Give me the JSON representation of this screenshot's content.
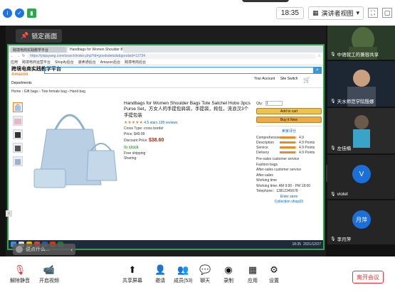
{
  "topbar": {
    "clock": "18:35",
    "view_label": "演讲者视图",
    "icons": [
      "info-icon",
      "shield-icon",
      "signal-icon"
    ]
  },
  "share": {
    "lock_label": "锁定画面",
    "browser_tabs": [
      "跨境电商实践教学平台",
      "Handbags for Women Shoulder B"
    ],
    "url": "https://yiqiuyang.com/search/index.php?id=goodsdetails&goodsid=12734",
    "bookmarks": [
      "应用",
      "跨境电商运营平台",
      "Shopify后台",
      "速卖通后台",
      "Amazon后台",
      "跨境电商后台"
    ],
    "site_name": "跨境电商实践教学平台",
    "amazon": "Amazon",
    "account": "Your Account",
    "site_switch": "Site Switch",
    "departments": "Departments",
    "breadcrumb": "Home › Gift bags › Tote female bag › Hand bag",
    "product_title": "Handbags for Women Shoulder Bags Tote Satchel Hobo 3pcs Purse Set，方女人的手提包肩袋，手提袋，挎包，流浪汉3个手提包装",
    "reviews": "4.5 stars 128 reviews",
    "shop_type": "Cross Type: cross border",
    "list_price": "Price: $49.99",
    "deal_label": "Discount Price:",
    "deal_price": "$38.60",
    "stock": "In stock",
    "shipping": "Free shipping",
    "sharing": "Sharing:",
    "qty_label": "Qty:",
    "qty_value": "1",
    "add_to_cart": "Add to cart",
    "buy_now": "Buy it Now",
    "rating_title": "卖家评分",
    "ratings": [
      {
        "label": "Comprehensive",
        "value": 0.9,
        "text": "4.9"
      },
      {
        "label": "Description",
        "value": 0.9,
        "text": "4.9 Points"
      },
      {
        "label": "Service",
        "value": 0.9,
        "text": "4.9 Points"
      },
      {
        "label": "Delivery",
        "value": 0.9,
        "text": "4.9 Points"
      }
    ],
    "seller_online": "Pre-sales customer service",
    "seller_name": "Fashion bags",
    "after_sales": "After-sales customer service",
    "after_name": "After-sales",
    "working_time": "Working time",
    "working_hours": "Working time: AM 9:00 - PM 18:00",
    "telephone": "Telephone：13812345678",
    "shop_link": "Enter store",
    "collect_link": "Collection shop(0)",
    "tray_time": "18:35",
    "tray_date": "2021/12/27",
    "chat_placeholder": "说点什么..."
  },
  "participants": [
    {
      "name": "中语就工的兼容共享",
      "muted": true,
      "bg": "#2e4a2e"
    },
    {
      "name": "天水师范学院殷娜",
      "muted": true,
      "bg": "#22324a"
    },
    {
      "name": "左佳楠",
      "muted": true,
      "bg": "#333"
    },
    {
      "name": "violet",
      "muted": true,
      "initial": "V",
      "bg": "#252525"
    },
    {
      "name": "李月萍",
      "muted": false,
      "initial": "月萍",
      "bg": "#252525"
    }
  ],
  "toolbar": {
    "unmute": "解除静音",
    "start_video": "开启视频",
    "share_screen": "共享屏幕",
    "invite": "邀请",
    "members": "成员(53)",
    "chat": "聊天",
    "record": "录制",
    "apps": "应用",
    "settings": "设置",
    "leave": "离开会议"
  }
}
